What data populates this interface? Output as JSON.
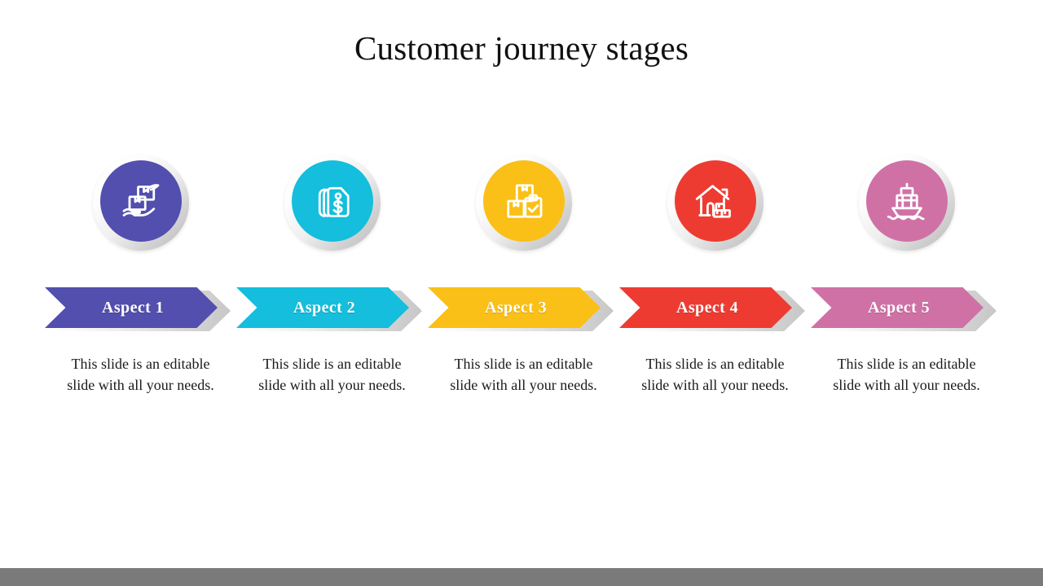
{
  "slide": {
    "title": "Customer journey stages",
    "background_color": "#ffffff",
    "bottom_bar_color": "#7a7a7a"
  },
  "stages": [
    {
      "label": "Aspect 1",
      "description": "This slide is an editable slide with all your needs.",
      "color": "#524FAF",
      "icon": "hand-holding-package-icon"
    },
    {
      "label": "Aspect 2",
      "description": "This slide is an editable slide with all your needs.",
      "color": "#14BEDC",
      "icon": "price-tag-dollar-icon"
    },
    {
      "label": "Aspect 3",
      "description": "This slide is an editable slide with all your needs.",
      "color": "#FAC017",
      "icon": "boxes-clipboard-check-icon"
    },
    {
      "label": "Aspect 4",
      "description": "This slide is an editable slide with all your needs.",
      "color": "#EE3B32",
      "icon": "house-with-boxes-icon"
    },
    {
      "label": "Aspect 5",
      "description": "This slide is an editable slide with all your needs.",
      "color": "#D071A6",
      "icon": "cargo-ship-icon"
    }
  ]
}
